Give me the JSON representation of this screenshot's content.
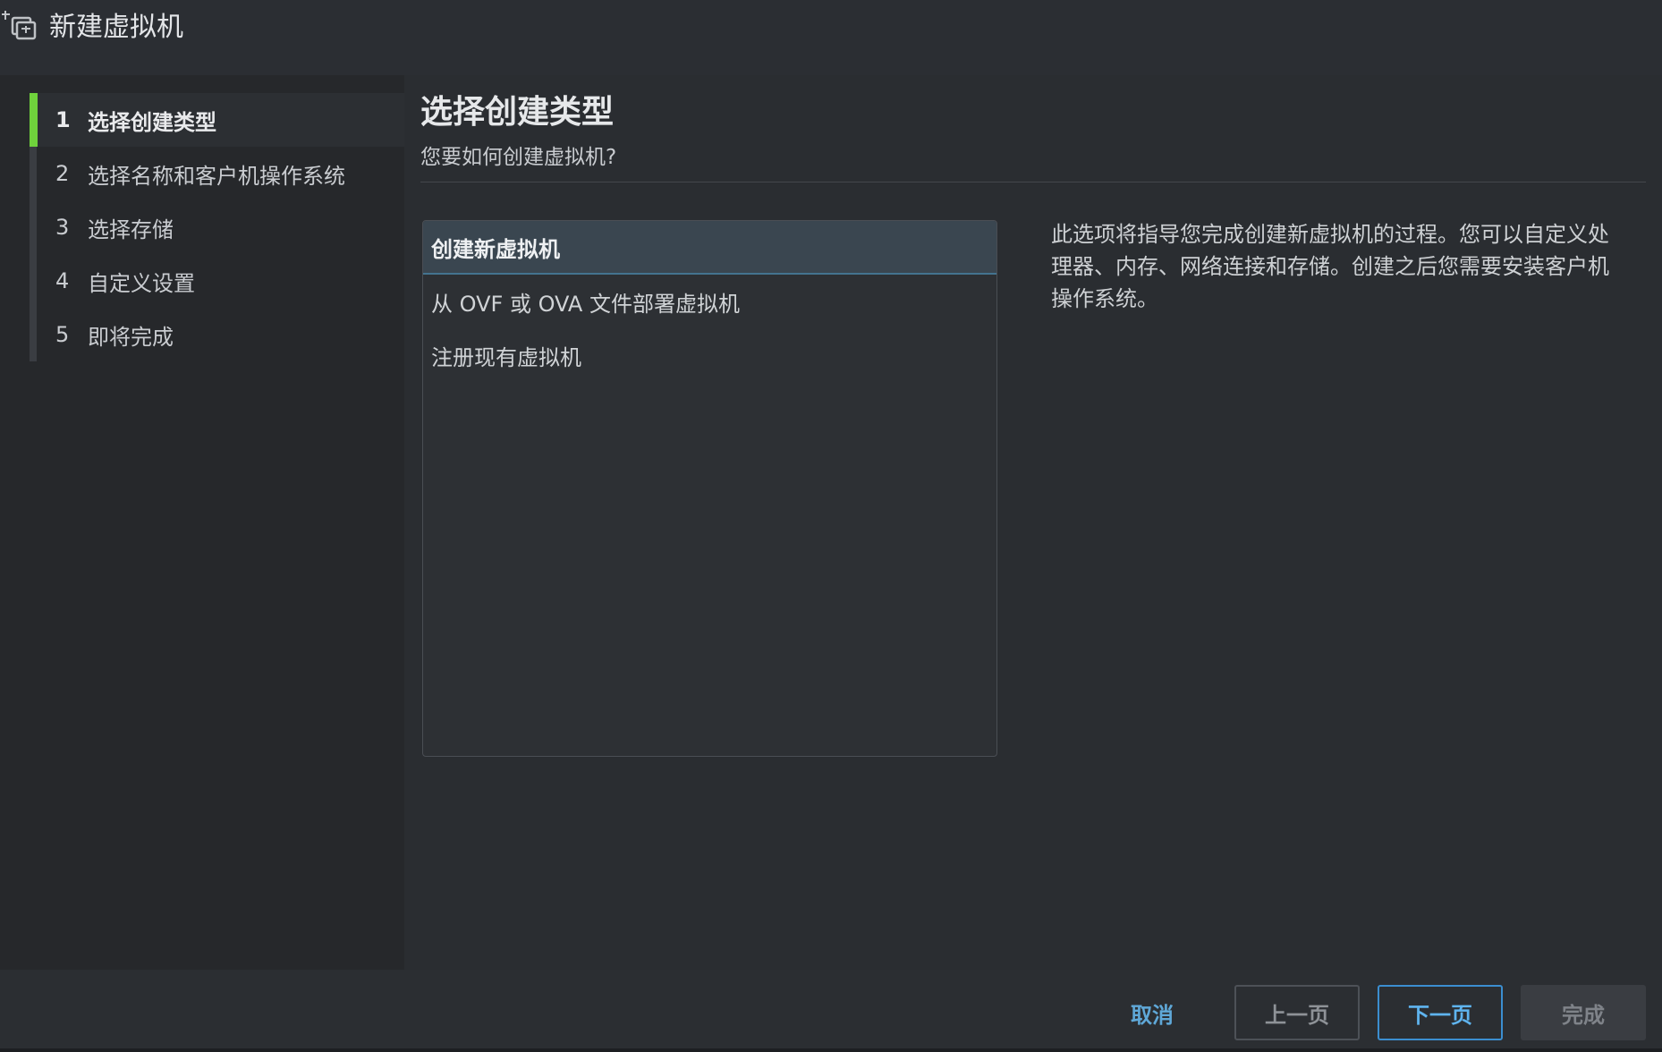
{
  "window": {
    "title": "新建虚拟机",
    "icon": "new-vm-icon"
  },
  "sidebar": {
    "steps": [
      {
        "num": "1",
        "label": "选择创建类型",
        "active": true
      },
      {
        "num": "2",
        "label": "选择名称和客户机操作系统",
        "active": false
      },
      {
        "num": "3",
        "label": "选择存储",
        "active": false
      },
      {
        "num": "4",
        "label": "自定义设置",
        "active": false
      },
      {
        "num": "5",
        "label": "即将完成",
        "active": false
      }
    ],
    "active_color": "#6fd23c"
  },
  "main": {
    "title": "选择创建类型",
    "subtitle": "您要如何创建虚拟机?",
    "options": [
      {
        "label": "创建新虚拟机",
        "selected": true
      },
      {
        "label": "从 OVF 或 OVA 文件部署虚拟机",
        "selected": false
      },
      {
        "label": "注册现有虚拟机",
        "selected": false
      }
    ],
    "description": "此选项将指导您完成创建新虚拟机的过程。您可以自定义处理器、内存、网络连接和存储。创建之后您需要安装客户机操作系统。"
  },
  "footer": {
    "cancel_label": "取消",
    "prev_label": "上一页",
    "next_label": "下一页",
    "finish_label": "完成"
  }
}
